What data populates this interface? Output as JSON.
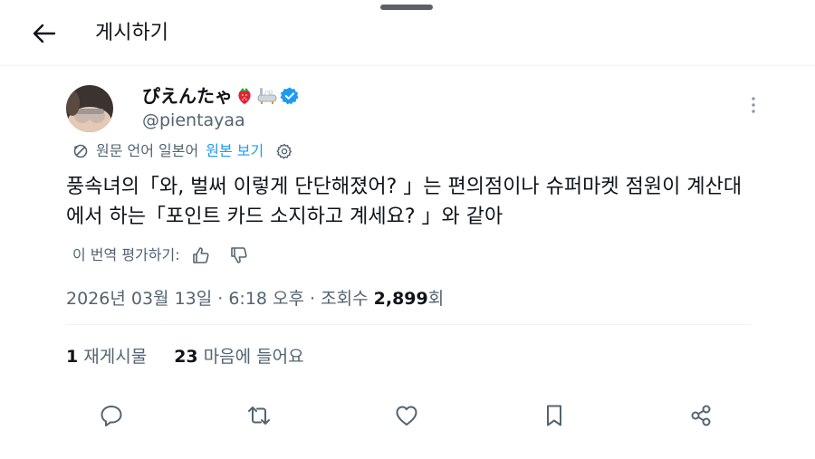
{
  "header": {
    "title": "게시하기",
    "back_icon": "arrow-left-icon"
  },
  "author": {
    "name": "ぴえんたゃ",
    "handle": "@pientayaa",
    "badges": [
      "strawberry-emoji-icon",
      "bathtub-emoji-icon",
      "verified-badge-icon"
    ]
  },
  "translation": {
    "source_label": "원문 언어 일본어",
    "show_original": "원본 보기"
  },
  "tweet": {
    "text": "풍속녀의「와, 벌써 이렇게 단단해졌어? 」는 편의점이나 슈퍼마켓 점원이 계산대에서 하는「포인트 카드 소지하고 계세요? 」와 같아"
  },
  "rate_translation": {
    "label": "이 번역 평가하기:"
  },
  "meta": {
    "datetime": "2026년 03월 13일 · 6:18 오후 · 조회수 ",
    "views": "2,899",
    "views_suffix": "회"
  },
  "stats": {
    "reposts_count": "1",
    "reposts_label": "재게시물",
    "likes_count": "23",
    "likes_label": "마음에 들어요"
  },
  "actions": [
    "reply-icon",
    "repost-icon",
    "like-icon",
    "bookmark-icon",
    "share-icon"
  ],
  "colors": {
    "accent": "#1d9bf0",
    "text": "#0f1419",
    "muted": "#536471"
  }
}
